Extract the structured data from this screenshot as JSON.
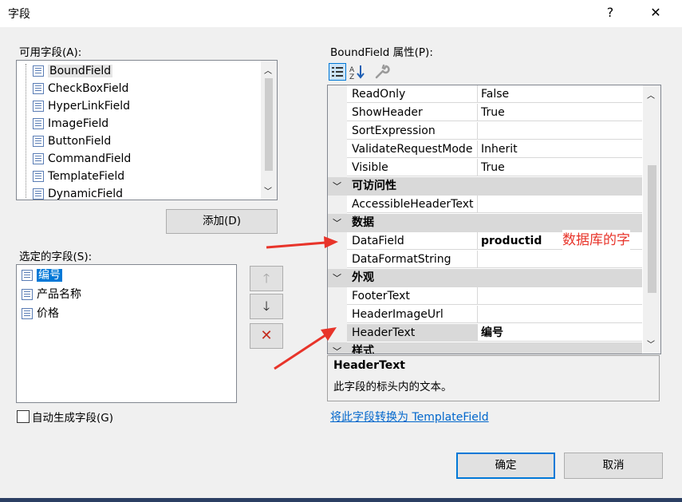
{
  "dialog": {
    "title": "字段",
    "help": "?",
    "close": "✕"
  },
  "available": {
    "label": "可用字段(A):",
    "items": [
      "BoundField",
      "CheckBoxField",
      "HyperLinkField",
      "ImageField",
      "ButtonField",
      "CommandField",
      "TemplateField",
      "DynamicField"
    ]
  },
  "add_button": "添加(D)",
  "selected": {
    "label": "选定的字段(S):",
    "items": [
      "编号",
      "产品名称",
      "价格"
    ]
  },
  "move_buttons": {
    "up": "🡑",
    "down": "🡓",
    "delete": "✕"
  },
  "auto_generate": {
    "label": "自动生成字段(G)",
    "checked": false
  },
  "properties": {
    "label": "BoundField 属性(P):",
    "rows": [
      {
        "name": "ReadOnly",
        "value": "False"
      },
      {
        "name": "ShowHeader",
        "value": "True"
      },
      {
        "name": "SortExpression",
        "value": ""
      },
      {
        "name": "ValidateRequestMode",
        "value": "Inherit"
      },
      {
        "name": "Visible",
        "value": "True"
      },
      {
        "category": "可访问性"
      },
      {
        "name": "AccessibleHeaderText",
        "value": ""
      },
      {
        "category": "数据"
      },
      {
        "name": "DataField",
        "value": "productid",
        "annotation": "数据库的字"
      },
      {
        "name": "DataFormatString",
        "value": ""
      },
      {
        "category": "外观"
      },
      {
        "name": "FooterText",
        "value": ""
      },
      {
        "name": "HeaderImageUrl",
        "value": ""
      },
      {
        "name": "HeaderText",
        "value": "编号"
      },
      {
        "category": "样式"
      }
    ]
  },
  "description": {
    "title": "HeaderText",
    "text": "此字段的标头内的文本。"
  },
  "convert_link": "将此字段转换为 TemplateField",
  "ok_button": "确定",
  "cancel_button": "取消",
  "colors": {
    "accent": "#0078d7",
    "annotation": "#e8342a",
    "arrow": "#e8342a"
  }
}
